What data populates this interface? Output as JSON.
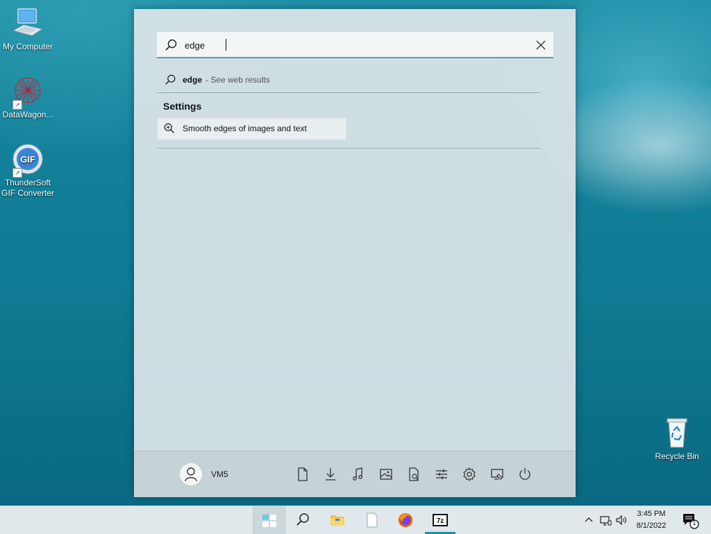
{
  "desktop": {
    "icons": [
      {
        "label": "My Computer"
      },
      {
        "label": "DataWagon..."
      },
      {
        "label": "ThunderSoft GIF Converter"
      },
      {
        "label": "Recycle Bin"
      }
    ],
    "gif_badge": "GIF"
  },
  "start_menu": {
    "search": {
      "value": "edge",
      "placeholder": ""
    },
    "web_result": {
      "query": "edge",
      "hint": "- See web results"
    },
    "settings": {
      "heading": "Settings",
      "items": [
        {
          "label": "Smooth edges of images and text"
        }
      ]
    },
    "footer": {
      "user_name": "VM5",
      "buttons": [
        "documents-icon",
        "downloads-icon",
        "music-icon",
        "pictures-icon",
        "videos-icon",
        "network-icon",
        "settings-icon",
        "personalization-icon",
        "power-icon"
      ]
    }
  },
  "taskbar": {
    "apps": [
      "start-icon",
      "search-icon",
      "file-explorer-icon",
      "notepad-icon",
      "firefox-icon",
      "7zip-icon"
    ],
    "seven_zip_label": "7z",
    "clock": {
      "time": "3:45 PM",
      "date": "8/1/2022"
    },
    "notification_count": "1"
  },
  "colors": {
    "accent": "#1e8fa7",
    "panel": "#d6e2e6"
  }
}
